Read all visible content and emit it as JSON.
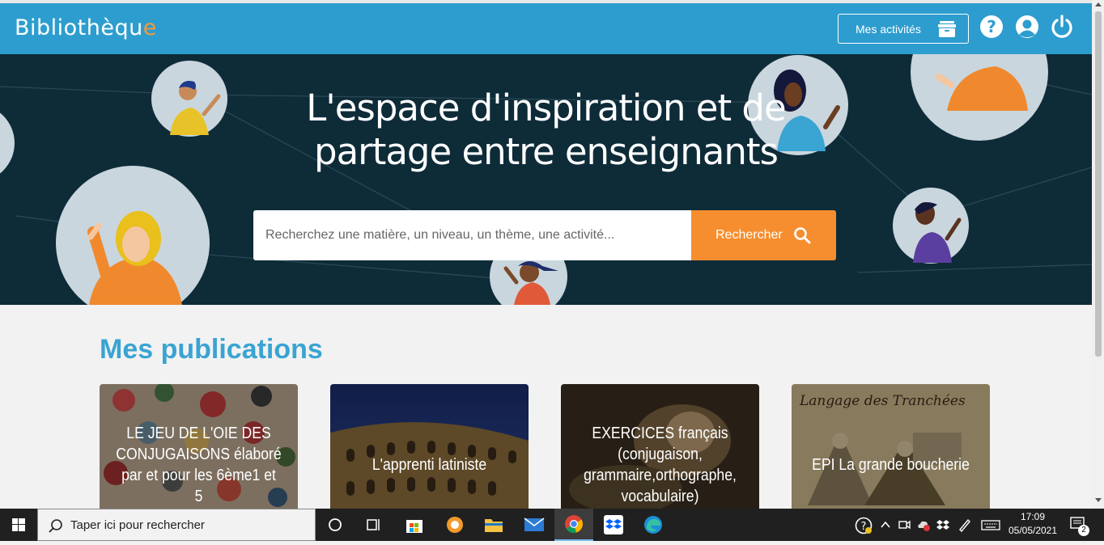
{
  "header": {
    "logo_main": "Bibliothèqu",
    "logo_accent": "e",
    "activities_label": "Mes activités"
  },
  "hero": {
    "title_line1": "L'espace d'inspiration et de",
    "title_line2": "partage entre enseignants",
    "search_placeholder": "Recherchez une matière, un niveau, un thème, une activité...",
    "search_button": "Rechercher"
  },
  "main": {
    "section_title": "Mes publications",
    "cards": [
      {
        "title": "LE JEU DE L'OIE DES CONJUGAISONS élaboré par et pour les 6ème1 et 5"
      },
      {
        "title": "L'apprenti latiniste"
      },
      {
        "title": "EXERCICES français (conjugaison, grammaire,orthographe, vocabulaire)"
      },
      {
        "title": "EPI La grande boucherie"
      }
    ]
  },
  "taskbar": {
    "search_placeholder": "Taper ici pour rechercher",
    "time": "17:09",
    "date": "05/05/2021",
    "notifications_count": "2"
  },
  "colors": {
    "header": "#2d9dcf",
    "hero": "#0e2b38",
    "accent": "#f68e2f",
    "section_title": "#3aa4d2"
  }
}
